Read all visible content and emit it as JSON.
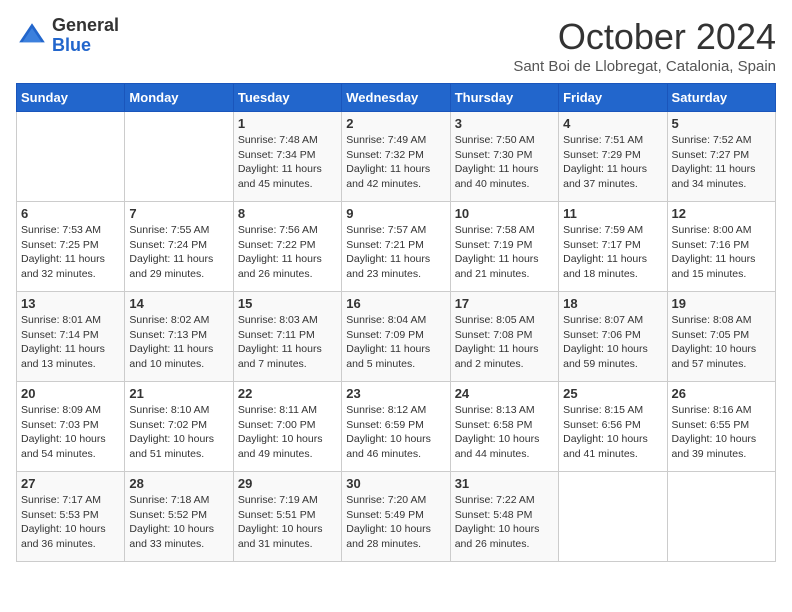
{
  "header": {
    "logo_general": "General",
    "logo_blue": "Blue",
    "month_title": "October 2024",
    "subtitle": "Sant Boi de Llobregat, Catalonia, Spain"
  },
  "days_of_week": [
    "Sunday",
    "Monday",
    "Tuesday",
    "Wednesday",
    "Thursday",
    "Friday",
    "Saturday"
  ],
  "weeks": [
    [
      {
        "day": "",
        "info": ""
      },
      {
        "day": "",
        "info": ""
      },
      {
        "day": "1",
        "info": "Sunrise: 7:48 AM\nSunset: 7:34 PM\nDaylight: 11 hours and 45 minutes."
      },
      {
        "day": "2",
        "info": "Sunrise: 7:49 AM\nSunset: 7:32 PM\nDaylight: 11 hours and 42 minutes."
      },
      {
        "day": "3",
        "info": "Sunrise: 7:50 AM\nSunset: 7:30 PM\nDaylight: 11 hours and 40 minutes."
      },
      {
        "day": "4",
        "info": "Sunrise: 7:51 AM\nSunset: 7:29 PM\nDaylight: 11 hours and 37 minutes."
      },
      {
        "day": "5",
        "info": "Sunrise: 7:52 AM\nSunset: 7:27 PM\nDaylight: 11 hours and 34 minutes."
      }
    ],
    [
      {
        "day": "6",
        "info": "Sunrise: 7:53 AM\nSunset: 7:25 PM\nDaylight: 11 hours and 32 minutes."
      },
      {
        "day": "7",
        "info": "Sunrise: 7:55 AM\nSunset: 7:24 PM\nDaylight: 11 hours and 29 minutes."
      },
      {
        "day": "8",
        "info": "Sunrise: 7:56 AM\nSunset: 7:22 PM\nDaylight: 11 hours and 26 minutes."
      },
      {
        "day": "9",
        "info": "Sunrise: 7:57 AM\nSunset: 7:21 PM\nDaylight: 11 hours and 23 minutes."
      },
      {
        "day": "10",
        "info": "Sunrise: 7:58 AM\nSunset: 7:19 PM\nDaylight: 11 hours and 21 minutes."
      },
      {
        "day": "11",
        "info": "Sunrise: 7:59 AM\nSunset: 7:17 PM\nDaylight: 11 hours and 18 minutes."
      },
      {
        "day": "12",
        "info": "Sunrise: 8:00 AM\nSunset: 7:16 PM\nDaylight: 11 hours and 15 minutes."
      }
    ],
    [
      {
        "day": "13",
        "info": "Sunrise: 8:01 AM\nSunset: 7:14 PM\nDaylight: 11 hours and 13 minutes."
      },
      {
        "day": "14",
        "info": "Sunrise: 8:02 AM\nSunset: 7:13 PM\nDaylight: 11 hours and 10 minutes."
      },
      {
        "day": "15",
        "info": "Sunrise: 8:03 AM\nSunset: 7:11 PM\nDaylight: 11 hours and 7 minutes."
      },
      {
        "day": "16",
        "info": "Sunrise: 8:04 AM\nSunset: 7:09 PM\nDaylight: 11 hours and 5 minutes."
      },
      {
        "day": "17",
        "info": "Sunrise: 8:05 AM\nSunset: 7:08 PM\nDaylight: 11 hours and 2 minutes."
      },
      {
        "day": "18",
        "info": "Sunrise: 8:07 AM\nSunset: 7:06 PM\nDaylight: 10 hours and 59 minutes."
      },
      {
        "day": "19",
        "info": "Sunrise: 8:08 AM\nSunset: 7:05 PM\nDaylight: 10 hours and 57 minutes."
      }
    ],
    [
      {
        "day": "20",
        "info": "Sunrise: 8:09 AM\nSunset: 7:03 PM\nDaylight: 10 hours and 54 minutes."
      },
      {
        "day": "21",
        "info": "Sunrise: 8:10 AM\nSunset: 7:02 PM\nDaylight: 10 hours and 51 minutes."
      },
      {
        "day": "22",
        "info": "Sunrise: 8:11 AM\nSunset: 7:00 PM\nDaylight: 10 hours and 49 minutes."
      },
      {
        "day": "23",
        "info": "Sunrise: 8:12 AM\nSunset: 6:59 PM\nDaylight: 10 hours and 46 minutes."
      },
      {
        "day": "24",
        "info": "Sunrise: 8:13 AM\nSunset: 6:58 PM\nDaylight: 10 hours and 44 minutes."
      },
      {
        "day": "25",
        "info": "Sunrise: 8:15 AM\nSunset: 6:56 PM\nDaylight: 10 hours and 41 minutes."
      },
      {
        "day": "26",
        "info": "Sunrise: 8:16 AM\nSunset: 6:55 PM\nDaylight: 10 hours and 39 minutes."
      }
    ],
    [
      {
        "day": "27",
        "info": "Sunrise: 7:17 AM\nSunset: 5:53 PM\nDaylight: 10 hours and 36 minutes."
      },
      {
        "day": "28",
        "info": "Sunrise: 7:18 AM\nSunset: 5:52 PM\nDaylight: 10 hours and 33 minutes."
      },
      {
        "day": "29",
        "info": "Sunrise: 7:19 AM\nSunset: 5:51 PM\nDaylight: 10 hours and 31 minutes."
      },
      {
        "day": "30",
        "info": "Sunrise: 7:20 AM\nSunset: 5:49 PM\nDaylight: 10 hours and 28 minutes."
      },
      {
        "day": "31",
        "info": "Sunrise: 7:22 AM\nSunset: 5:48 PM\nDaylight: 10 hours and 26 minutes."
      },
      {
        "day": "",
        "info": ""
      },
      {
        "day": "",
        "info": ""
      }
    ]
  ]
}
